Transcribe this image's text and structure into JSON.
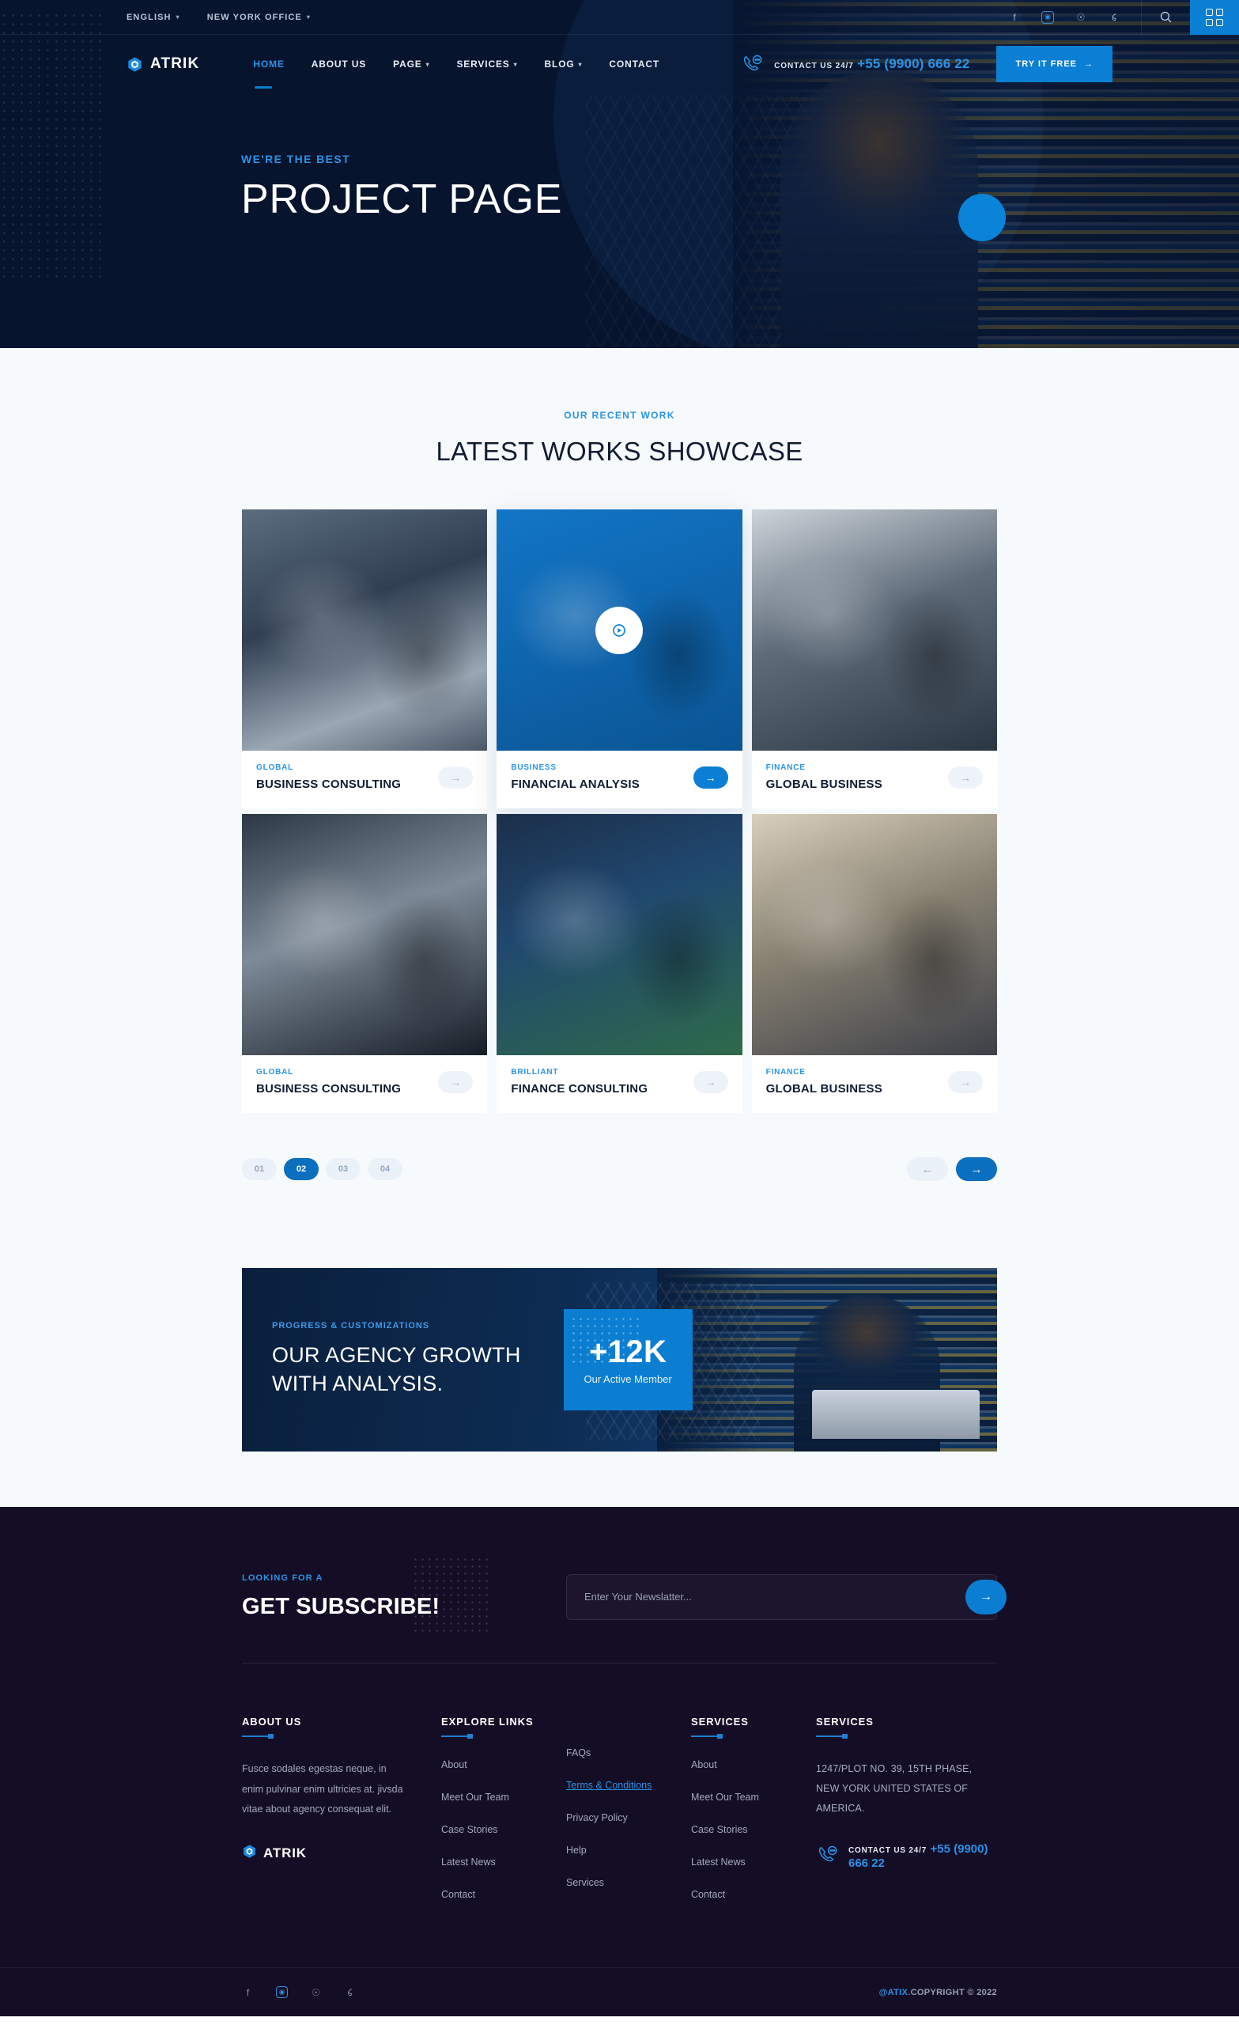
{
  "topbar": {
    "language": "ENGLISH",
    "office": "NEW YORK OFFICE",
    "socials": [
      "facebook-icon",
      "instagram-icon",
      "pinterest-icon",
      "behance-icon"
    ],
    "search_icon": "search-icon",
    "grid_icon": "grid-menu-icon"
  },
  "header": {
    "brand": "ATRIK",
    "nav": [
      {
        "label": "HOME",
        "active": true,
        "caret": false
      },
      {
        "label": "ABOUT US",
        "active": false,
        "caret": false
      },
      {
        "label": "PAGE",
        "active": false,
        "caret": true
      },
      {
        "label": "SERVICES",
        "active": false,
        "caret": true
      },
      {
        "label": "BLOG",
        "active": false,
        "caret": true
      },
      {
        "label": "CONTACT",
        "active": false,
        "caret": false
      }
    ],
    "contact_label": "CONTACT US 24/7",
    "contact_number": "+55 (9900) 666 22",
    "cta_button": "TRY IT FREE",
    "cta_arrow": "→"
  },
  "hero": {
    "kicker": "WE'RE THE BEST",
    "title": "PROJECT PAGE"
  },
  "works": {
    "kicker": "OUR RECENT WORK",
    "title": "LATEST WORKS SHOWCASE",
    "cards": [
      {
        "category": "GLOBAL",
        "title": "BUSINESS CONSULTING",
        "featured": false
      },
      {
        "category": "BUSINESS",
        "title": "FINANCIAL ANALYSIS",
        "featured": true
      },
      {
        "category": "FINANCE",
        "title": "GLOBAL BUSINESS",
        "featured": false
      },
      {
        "category": "GLOBAL",
        "title": "BUSINESS CONSULTING",
        "featured": false
      },
      {
        "category": "BRILLIANT",
        "title": "FINANCE CONSULTING",
        "featured": false
      },
      {
        "category": "FINANCE",
        "title": "GLOBAL BUSINESS",
        "featured": false
      }
    ],
    "pages": [
      {
        "label": "01",
        "active": false
      },
      {
        "label": "02",
        "active": true
      },
      {
        "label": "03",
        "active": false
      },
      {
        "label": "04",
        "active": false
      }
    ],
    "prev_arrow": "←",
    "next_arrow": "→"
  },
  "cta": {
    "kicker": "PROGRESS & CUSTOMIZATIONS",
    "line1": "OUR AGENCY GROWTH",
    "line2": "WITH ANALYSIS.",
    "stat_number": "+12K",
    "stat_label": "Our Active Member"
  },
  "subscribe": {
    "kicker": "LOOKING FOR A",
    "title": "GET SUBSCRIBE!",
    "placeholder": "Enter Your Newslatter...",
    "value": "",
    "submit_arrow": "→"
  },
  "footer": {
    "col_about": {
      "heading": "ABOUT US",
      "text": "Fusce sodales egestas neque, in enim pulvinar enim ultricies at. jivsda vitae about agency  consequat elit.",
      "brand": "ATRIK"
    },
    "col_explore": {
      "heading": "EXPLORE LINKS",
      "links": [
        "About",
        "Meet Our Team",
        "Case Stories",
        "Latest News",
        "Contact"
      ]
    },
    "col_explore2": {
      "heading": "",
      "links": [
        "FAQs",
        "Terms & Conditions",
        "Privacy Policy",
        "Help",
        "Services"
      ],
      "highlighted": "Terms & Conditions"
    },
    "col_services": {
      "heading": "SERVICES",
      "links": [
        "About",
        "Meet Our Team",
        "Case Stories",
        "Latest News",
        "Contact"
      ]
    },
    "col_contact": {
      "heading": "SERVICES",
      "address": "1247/PLOT NO. 39, 15TH PHASE, NEW YORK UNITED STATES OF AMERICA.",
      "contact_label": "CONTACT US 24/7",
      "contact_number": "+55 (9900) 666 22"
    },
    "socials": [
      "facebook-icon",
      "instagram-icon",
      "pinterest-icon",
      "behance-icon"
    ],
    "copyright_brand": "@ATIX.",
    "copyright_text": "COPYRIGHT © 2022"
  },
  "colors": {
    "accent": "#0a7fd4",
    "accent_light": "#2b93e6",
    "hero_bg": "#07142e",
    "section_bg": "#f7fafd",
    "footer_bg": "#140d26"
  }
}
